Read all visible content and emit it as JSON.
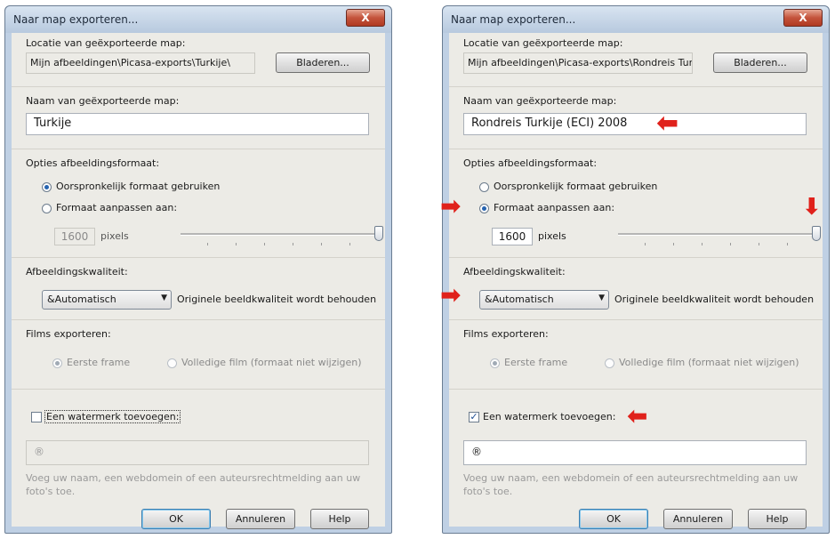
{
  "left": {
    "title": "Naar map exporteren...",
    "close": "X",
    "location_label": "Locatie van geëxporteerde map:",
    "location_value": "Mijn afbeeldingen\\Picasa-exports\\Turkije\\",
    "browse": "Bladeren...",
    "name_label": "Naam van geëxporteerde map:",
    "name_value": "Turkije",
    "size_options_label": "Opties afbeeldingsformaat:",
    "radio_original": "Oorspronkelijk formaat gebruiken",
    "radio_resize": "Formaat aanpassen aan:",
    "pixels_value": "1600",
    "pixels_unit": "pixels",
    "quality_label": "Afbeeldingskwaliteit:",
    "quality_value": "&Automatisch",
    "quality_note": "Originele beeldkwaliteit wordt behouden",
    "films_label": "Films exporteren:",
    "films_first": "Eerste frame",
    "films_full": "Volledige film (formaat niet wijzigen)",
    "watermark_label": "Een watermerk toevoegen:",
    "watermark_checked": false,
    "watermark_value": "®",
    "watermark_help": "Voeg uw naam, een webdomein of een auteursrechtmelding aan uw foto's toe.",
    "ok": "OK",
    "cancel": "Annuleren",
    "help": "Help"
  },
  "right": {
    "title": "Naar map exporteren...",
    "close": "X",
    "location_label": "Locatie van geëxporteerde map:",
    "location_value": "Mijn afbeeldingen\\Picasa-exports\\Rondreis Tur",
    "browse": "Bladeren...",
    "name_label": "Naam van geëxporteerde map:",
    "name_value": "Rondreis Turkije (ECI) 2008",
    "size_options_label": "Opties afbeeldingsformaat:",
    "radio_original": "Oorspronkelijk formaat gebruiken",
    "radio_resize": "Formaat aanpassen aan:",
    "pixels_value": "1600",
    "pixels_unit": "pixels",
    "quality_label": "Afbeeldingskwaliteit:",
    "quality_value": "&Automatisch",
    "quality_note": "Originele beeldkwaliteit wordt behouden",
    "films_label": "Films exporteren:",
    "films_first": "Eerste frame",
    "films_full": "Volledige film (formaat niet wijzigen)",
    "watermark_label": "Een watermerk toevoegen:",
    "watermark_checked": true,
    "watermark_value": "®",
    "watermark_help": "Voeg uw naam, een webdomein of een auteursrechtmelding aan uw foto's toe.",
    "ok": "OK",
    "cancel": "Annuleren",
    "help": "Help"
  },
  "annotation_color": "#e0211b"
}
